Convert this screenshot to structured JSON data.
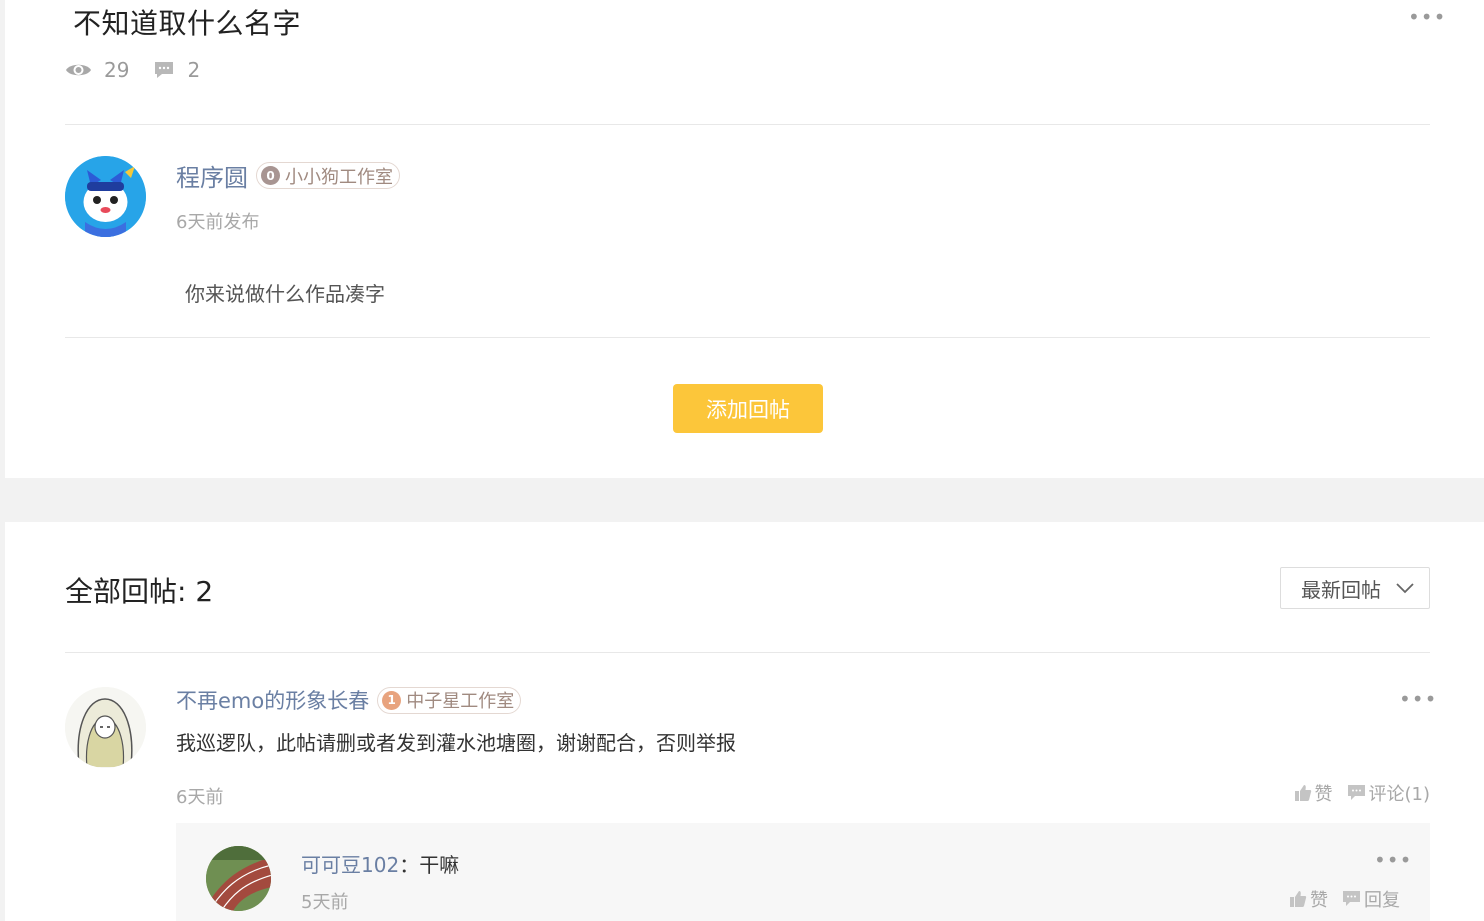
{
  "post": {
    "title": "不知道取什么名字",
    "views": "29",
    "comments": "2",
    "author": {
      "name": "程序圆",
      "level": "0",
      "studio": "小小狗工作室"
    },
    "time": "6天前发布",
    "body": "你来说做什么作品凑字",
    "add_reply_label": "添加回帖"
  },
  "replies": {
    "header": "全部回帖: 2",
    "sort_label": "最新回帖",
    "items": [
      {
        "author": "不再emo的形象长春",
        "level": "1",
        "studio": "中子星工作室",
        "text": "我巡逻队，此帖请删或者发到灌水池塘圈，谢谢配合，否则举报",
        "time": "6天前",
        "like_label": "赞",
        "comment_label": "评论(1)",
        "comments": [
          {
            "author": "可可豆102",
            "separator": "：",
            "text": "干嘛",
            "time": "5天前",
            "like_label": "赞",
            "reply_label": "回复"
          }
        ]
      }
    ]
  },
  "colors": {
    "accent": "#fcc63a",
    "link": "#6a7fa3",
    "muted": "#a8a8a8"
  }
}
